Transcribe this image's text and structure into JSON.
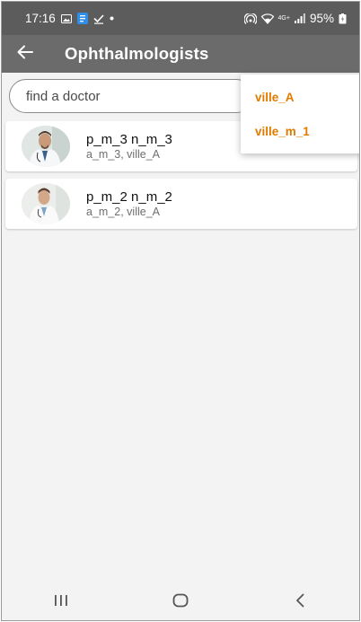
{
  "status_bar": {
    "time": "17:16",
    "network_label": "4G+",
    "battery": "95%"
  },
  "app_bar": {
    "title": "Ophthalmologists",
    "back_icon": "arrow-left-icon"
  },
  "search": {
    "placeholder": "find a doctor",
    "value": ""
  },
  "dropdown": {
    "options": [
      "ville_A",
      "ville_m_1"
    ]
  },
  "doctors": [
    {
      "name": "p_m_3 n_m_3",
      "details": "a_m_3, ville_A",
      "avatar": "doctor-photo"
    },
    {
      "name": "p_m_2 n_m_2",
      "details": "a_m_2, ville_A",
      "avatar": "doctor-photo"
    }
  ],
  "nav_bar": {
    "icons": [
      "recents-icon",
      "home-icon",
      "back-icon"
    ]
  },
  "colors": {
    "app_bar": "#6b6b6b",
    "status_bar": "#5c5c5c",
    "accent_orange": "#e07b00",
    "background": "#f3f3f3"
  }
}
